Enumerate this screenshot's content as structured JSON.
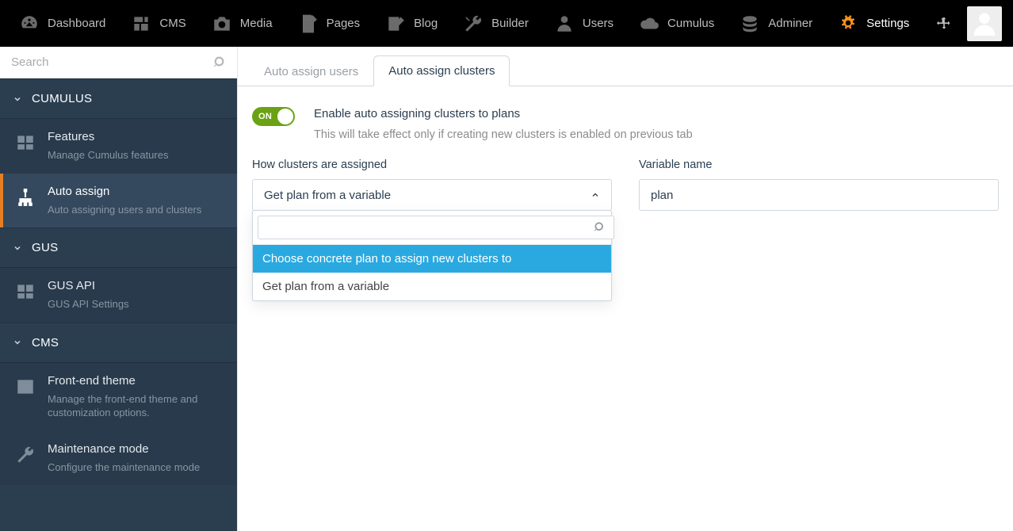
{
  "topnav": {
    "items": [
      {
        "label": "Dashboard",
        "icon": "gauge"
      },
      {
        "label": "CMS",
        "icon": "cms"
      },
      {
        "label": "Media",
        "icon": "camera"
      },
      {
        "label": "Pages",
        "icon": "pages"
      },
      {
        "label": "Blog",
        "icon": "pencil-note"
      },
      {
        "label": "Builder",
        "icon": "wrench"
      },
      {
        "label": "Users",
        "icon": "user"
      },
      {
        "label": "Cumulus",
        "icon": "cloud"
      },
      {
        "label": "Adminer",
        "icon": "database"
      },
      {
        "label": "Settings",
        "icon": "gears",
        "active": true
      }
    ]
  },
  "sidebar": {
    "search_placeholder": "Search",
    "groups": [
      {
        "title": "CUMULUS",
        "items": [
          {
            "title": "Features",
            "desc": "Manage Cumulus features",
            "icon": "boxes"
          },
          {
            "title": "Auto assign",
            "desc": "Auto assigning users and clusters",
            "icon": "sitemap",
            "active": true
          }
        ]
      },
      {
        "title": "GUS",
        "items": [
          {
            "title": "GUS API",
            "desc": "GUS API Settings",
            "icon": "boxes"
          }
        ]
      },
      {
        "title": "CMS",
        "items": [
          {
            "title": "Front-end theme",
            "desc": "Manage the front-end theme and customization options.",
            "icon": "image"
          },
          {
            "title": "Maintenance mode",
            "desc": "Configure the maintenance mode",
            "icon": "wrench"
          }
        ]
      }
    ]
  },
  "tabs": [
    {
      "label": "Auto assign users"
    },
    {
      "label": "Auto assign clusters",
      "active": true
    }
  ],
  "toggle": {
    "state": "ON",
    "title": "Enable auto assigning clusters to plans",
    "desc": "This will take effect only if creating new clusters is enabled on previous tab"
  },
  "assign": {
    "label": "How clusters are assigned",
    "selected": "Get plan from a variable",
    "dropdown_search": "",
    "options": [
      {
        "label": "Choose concrete plan to assign new clusters to",
        "highlighted": true
      },
      {
        "label": "Get plan from a variable"
      }
    ]
  },
  "variable": {
    "label": "Variable name",
    "value": "plan"
  }
}
